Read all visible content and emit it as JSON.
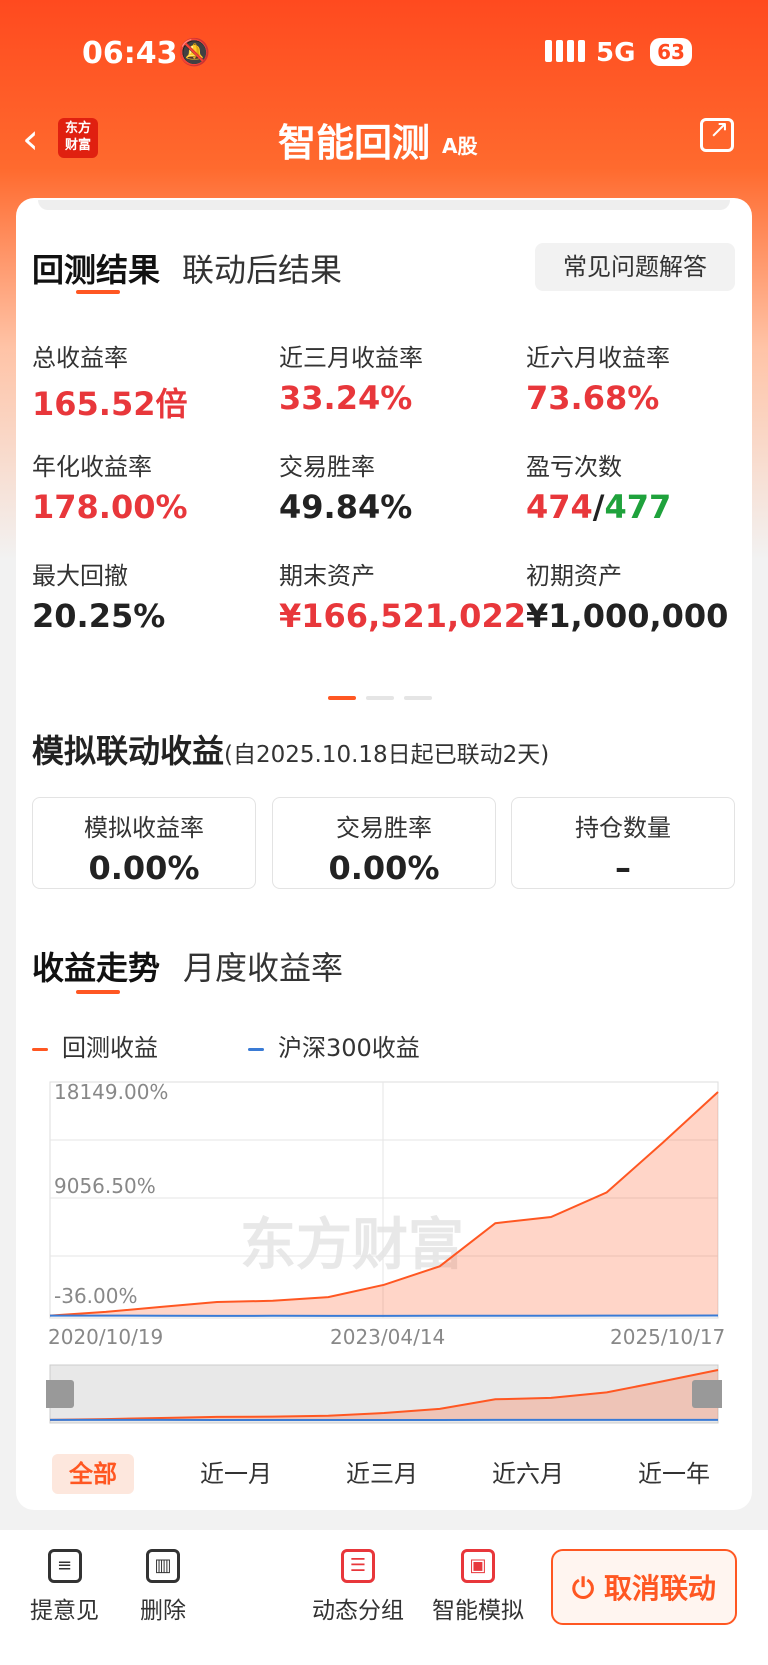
{
  "status_bar": {
    "time": "06:43",
    "network": "5G",
    "battery": "63"
  },
  "nav": {
    "logo_line1": "东方",
    "logo_line2": "财富",
    "title": "智能回测",
    "title_tag": "A股"
  },
  "result_tabs": [
    {
      "label": "回测结果"
    },
    {
      "label": "联动后结果"
    }
  ],
  "faq_button": "常见问题解答",
  "metrics": [
    {
      "label": "总收益率",
      "value": "165.52倍"
    },
    {
      "label": "近三月收益率",
      "value": "33.24%"
    },
    {
      "label": "近六月收益率",
      "value": "73.68%"
    },
    {
      "label": "年化收益率",
      "value": "178.00%"
    },
    {
      "label": "交易胜率",
      "value": "49.84%"
    },
    {
      "label": "盈亏次数",
      "win": "474",
      "sep": "/",
      "loss": "477"
    },
    {
      "label": "最大回撤",
      "value": "20.25%"
    },
    {
      "label": "期末资产",
      "value": "¥166,521,022"
    },
    {
      "label": "初期资产",
      "value": "¥1,000,000"
    }
  ],
  "sim": {
    "title": "模拟联动收益",
    "subtitle": "(自2025.10.18日起已联动2天)",
    "boxes": [
      {
        "label": "模拟收益率",
        "value": "0.00%"
      },
      {
        "label": "交易胜率",
        "value": "0.00%"
      },
      {
        "label": "持仓数量",
        "value": "–"
      }
    ]
  },
  "trend_tabs": [
    {
      "label": "收益走势"
    },
    {
      "label": "月度收益率"
    }
  ],
  "legend": [
    {
      "label": "回测收益",
      "color": "#ff5722"
    },
    {
      "label": "沪深300收益",
      "color": "#3a7bd5"
    }
  ],
  "chart": {
    "y_ticks": [
      "18149.00%",
      "9056.50%",
      "-36.00%"
    ],
    "x_ticks": [
      "2020/10/19",
      "2023/04/14",
      "2025/10/17"
    ],
    "watermark": "东方财富"
  },
  "chart_data": {
    "type": "area",
    "x": [
      "2020/10/19",
      "2021/06",
      "2022/01",
      "2022/09",
      "2023/04/14",
      "2023/11",
      "2024/06",
      "2024/09",
      "2024/12",
      "2025/03",
      "2025/06",
      "2025/08",
      "2025/10/17"
    ],
    "series": [
      {
        "name": "回测收益",
        "values": [
          0,
          300,
          700,
          1100,
          1200,
          1500,
          2500,
          4000,
          7500,
          8000,
          10000,
          14000,
          18149
        ]
      },
      {
        "name": "沪深300收益",
        "values": [
          0,
          -5,
          -15,
          -25,
          -20,
          -30,
          -25,
          -20,
          -15,
          -10,
          -5,
          0,
          5
        ]
      }
    ],
    "ylim": [
      -36,
      18149
    ],
    "ylabel": "",
    "xlabel": ""
  },
  "ranges": [
    {
      "label": "全部"
    },
    {
      "label": "近一月"
    },
    {
      "label": "近三月"
    },
    {
      "label": "近六月"
    },
    {
      "label": "近一年"
    }
  ],
  "bottom_bar": [
    {
      "label": "提意见"
    },
    {
      "label": "删除"
    },
    {
      "label": "动态分组"
    },
    {
      "label": "智能模拟"
    }
  ],
  "cancel_button": "取消联动"
}
